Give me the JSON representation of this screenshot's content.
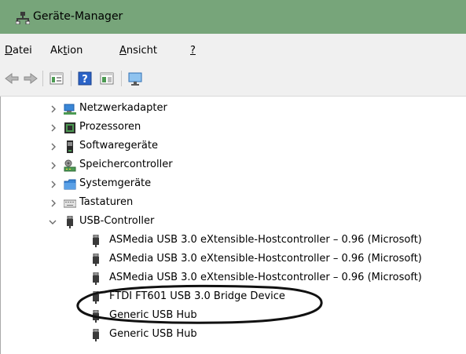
{
  "window": {
    "title": "Geräte-Manager",
    "accent_color": "#77a57a"
  },
  "menu": {
    "items": [
      {
        "pre": "",
        "u": "D",
        "post": "atei"
      },
      {
        "pre": "Ak",
        "u": "t",
        "post": "ion"
      },
      {
        "pre": "",
        "u": "A",
        "post": "nsicht"
      },
      {
        "pre": "",
        "u": "?",
        "post": ""
      }
    ]
  },
  "toolbar": {
    "buttons": [
      "back-arrow-icon",
      "forward-arrow-icon",
      "properties-icon",
      "help-icon",
      "view-icon",
      "scan-monitor-icon"
    ]
  },
  "tree": {
    "categories": [
      {
        "label": "Netzwerkadapter",
        "icon": "network-adapter-icon",
        "expanded": false
      },
      {
        "label": "Prozessoren",
        "icon": "processor-icon",
        "expanded": false
      },
      {
        "label": "Softwaregeräte",
        "icon": "software-device-icon",
        "expanded": false
      },
      {
        "label": "Speichercontroller",
        "icon": "storage-controller-icon",
        "expanded": false
      },
      {
        "label": "Systemgeräte",
        "icon": "system-device-icon",
        "expanded": false
      },
      {
        "label": "Tastaturen",
        "icon": "keyboard-icon",
        "expanded": false
      },
      {
        "label": "USB-Controller",
        "icon": "usb-icon",
        "expanded": true
      }
    ],
    "usb_devices": [
      {
        "label": "ASMedia USB 3.0 eXtensible-Hostcontroller – 0.96 (Microsoft)"
      },
      {
        "label": "ASMedia USB 3.0 eXtensible-Hostcontroller – 0.96 (Microsoft)"
      },
      {
        "label": "ASMedia USB 3.0 eXtensible-Hostcontroller – 0.96 (Microsoft)"
      },
      {
        "label": "FTDI FT601 USB 3.0 Bridge Device"
      },
      {
        "label": "Generic USB Hub"
      },
      {
        "label": "Generic USB Hub"
      }
    ]
  }
}
